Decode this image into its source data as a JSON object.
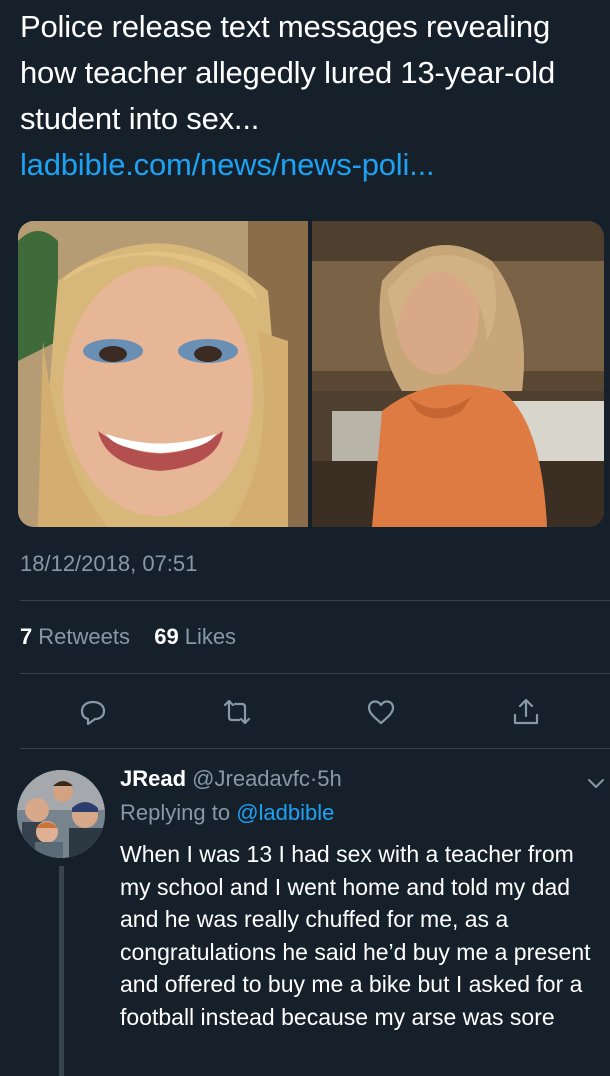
{
  "tweet": {
    "text": "Police release text messages revealing how teacher allegedly lured 13-year-old student into sex...",
    "link": "ladbible.com/news/news-poli...",
    "timestamp": "18/12/2018, 07:51",
    "retweets_count": "7",
    "retweets_label": "Retweets",
    "likes_count": "69",
    "likes_label": "Likes"
  },
  "reply": {
    "name": "JRead",
    "handle": "@Jreadavfc",
    "separator": "·",
    "time": "5h",
    "replying_prefix": "Replying to",
    "replying_to": "@ladbible",
    "body": "When I was 13 I had sex with a teacher from my school and I went home and told my dad and he was really chuffed for me, as a congratulations he said he’d buy me a present and offered to buy me a bike but I asked for a football instead because my arse was sore"
  },
  "icons": {
    "reply": "reply-icon",
    "retweet": "retweet-icon",
    "like": "heart-icon",
    "share": "share-icon",
    "menu": "chevron-down-icon"
  },
  "colors": {
    "background": "#15202b",
    "link": "#1da1f2",
    "secondary_text": "#8899a6",
    "divider": "#38444d"
  }
}
